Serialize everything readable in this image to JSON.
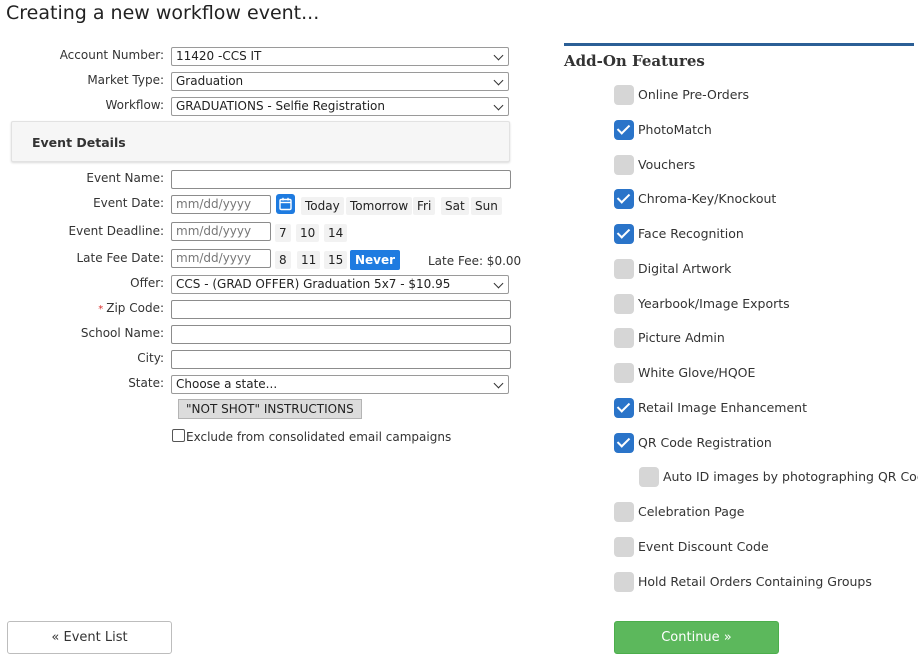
{
  "page_title": "Creating a new workflow event...",
  "form": {
    "account_number": {
      "label": "Account Number:",
      "value": "11420 -CCS IT"
    },
    "market_type": {
      "label": "Market Type:",
      "value": "Graduation"
    },
    "workflow": {
      "label": "Workflow:",
      "value": "GRADUATIONS - Selfie Registration"
    },
    "event_details_heading": "Event Details",
    "event_name": {
      "label": "Event Name:",
      "value": ""
    },
    "event_date": {
      "label": "Event Date:",
      "placeholder": "mm/dd/yyyy",
      "shortcuts": [
        "Today",
        "Tomorrow",
        "Fri",
        "Sat",
        "Sun"
      ]
    },
    "event_deadline": {
      "label": "Event Deadline:",
      "placeholder": "mm/dd/yyyy",
      "shortcuts": [
        "7",
        "10",
        "14"
      ]
    },
    "late_fee_date": {
      "label": "Late Fee Date:",
      "placeholder": "mm/dd/yyyy",
      "shortcuts": [
        "8",
        "11",
        "15"
      ],
      "never_label": "Never"
    },
    "late_fee": "Late Fee: $0.00",
    "offer": {
      "label": "Offer:",
      "value": "CCS - (GRAD OFFER) Graduation 5x7 - $10.95"
    },
    "zip_code": {
      "label": "Zip Code:",
      "required_mark": "*",
      "value": ""
    },
    "school_name": {
      "label": "School Name:",
      "value": ""
    },
    "city": {
      "label": "City:",
      "value": ""
    },
    "state": {
      "label": "State:",
      "value": "Choose a state..."
    },
    "not_shot_button": "\"NOT SHOT\" INSTRUCTIONS",
    "exclude_label": "Exclude from consolidated email campaigns",
    "exclude_checked": false
  },
  "buttons": {
    "event_list": "« Event List",
    "continue": "Continue »"
  },
  "addons": {
    "title": "Add-On Features",
    "accent_color": "#2b5f96",
    "items": [
      {
        "label": "Online Pre-Orders",
        "checked": false
      },
      {
        "label": "PhotoMatch",
        "checked": true
      },
      {
        "label": "Vouchers",
        "checked": false
      },
      {
        "label": "Chroma-Key/Knockout",
        "checked": true
      },
      {
        "label": "Face Recognition",
        "checked": true
      },
      {
        "label": "Digital Artwork",
        "checked": false
      },
      {
        "label": "Yearbook/Image Exports",
        "checked": false
      },
      {
        "label": "Picture Admin",
        "checked": false
      },
      {
        "label": "White Glove/HQOE",
        "checked": false
      },
      {
        "label": "Retail Image Enhancement",
        "checked": true
      },
      {
        "label": "QR Code Registration",
        "checked": true
      },
      {
        "label": "Auto ID images by photographing QR Code",
        "checked": false,
        "indent": true
      },
      {
        "label": "Celebration Page",
        "checked": false
      },
      {
        "label": "Event Discount Code",
        "checked": false
      },
      {
        "label": "Hold Retail Orders Containing Groups",
        "checked": false
      }
    ]
  }
}
